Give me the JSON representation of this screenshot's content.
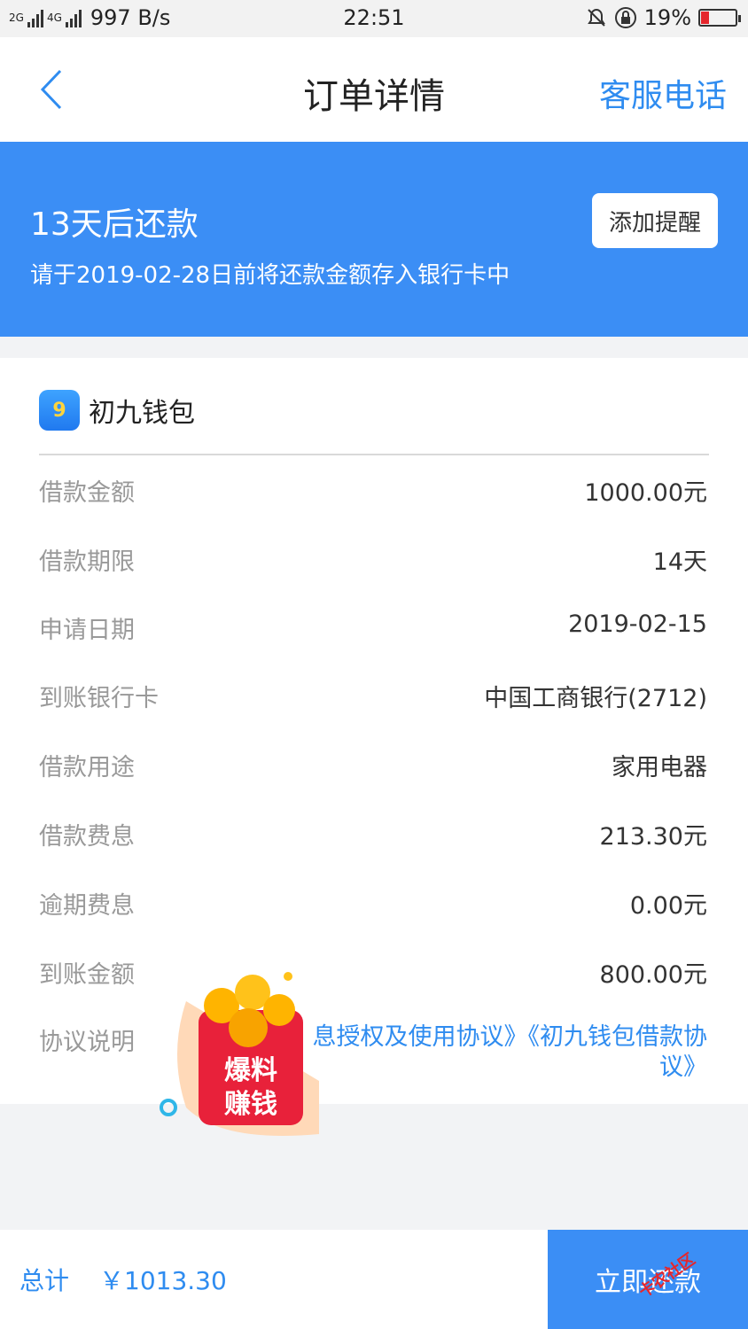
{
  "status_bar": {
    "net1": "2G",
    "net2": "4G",
    "speed": "997 B/s",
    "time": "22:51",
    "battery": "19%"
  },
  "nav": {
    "title": "订单详情",
    "service": "客服电话"
  },
  "banner": {
    "headline": "13天后还款",
    "sub": "请于2019-02-28日前将还款金额存入银行卡中",
    "remind": "添加提醒"
  },
  "card": {
    "brand": "初九钱包",
    "logo_digit": "9",
    "rows": [
      {
        "label": "借款金额",
        "value": "1000.00元"
      },
      {
        "label": "借款期限",
        "value": "14天"
      },
      {
        "label": "申请日期",
        "value": "2019-02-15"
      },
      {
        "label": "到账银行卡",
        "value": "中国工商银行(2712)"
      },
      {
        "label": "借款用途",
        "value": "家用电器"
      },
      {
        "label": "借款费息",
        "value": "213.30元"
      },
      {
        "label": "逾期费息",
        "value": "0.00元"
      },
      {
        "label": "到账金额",
        "value": "800.00元"
      }
    ],
    "agreement_label": "协议说明",
    "agreement_links": "息授权及使用协议》《初九钱包借款协议》"
  },
  "promo": {
    "line1": "爆料",
    "line2": "赚钱"
  },
  "bottom": {
    "total_label": "总计",
    "total_value": "￥1013.30",
    "pay": "立即还款"
  },
  "watermark": "卡农社区",
  "colors": {
    "accent": "#2f8cf0",
    "banner": "#3b8ef5",
    "alert": "#e5262c"
  }
}
